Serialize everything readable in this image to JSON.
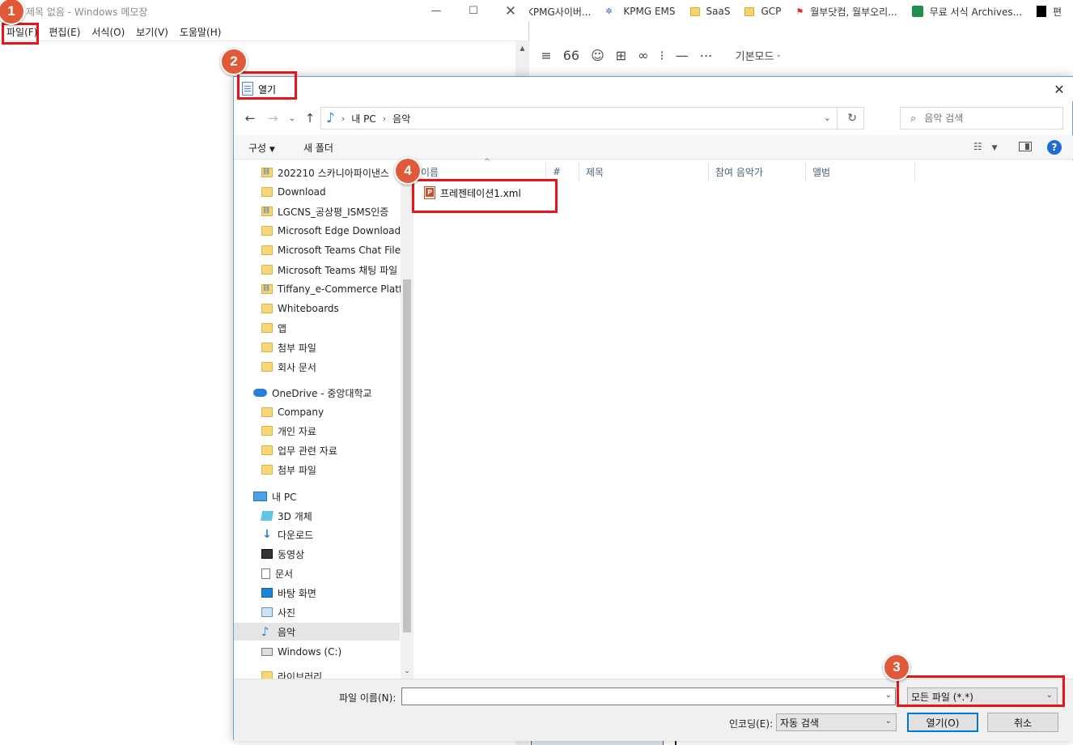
{
  "browser": {
    "bookmarks": [
      {
        "label": "정KPMG사이버...",
        "icon": "none"
      },
      {
        "label": "KPMG EMS",
        "icon": "kpmg-icon"
      },
      {
        "label": "SaaS",
        "icon": "folder-icon"
      },
      {
        "label": "GCP",
        "icon": "folder-icon"
      },
      {
        "label": "월부닷컴, 월부오리...",
        "icon": "flag-icon"
      },
      {
        "label": "무료 서식 Archives...",
        "icon": "green-icon"
      },
      {
        "label": "편",
        "icon": "black-icon"
      }
    ],
    "editor_toolbar": {
      "quote_glyph": "66",
      "mode_label": "기본모드"
    }
  },
  "notepad": {
    "title": "제목 없음 - Windows 메모장",
    "menus": [
      "파일(F)",
      "편집(E)",
      "서식(O)",
      "보기(V)",
      "도움말(H)"
    ]
  },
  "dialog": {
    "title": "열기",
    "breadcrumb": [
      "내 PC",
      "음악"
    ],
    "search_placeholder": "음악 검색",
    "commands": {
      "organize": "구성",
      "new_folder": "새 폴더"
    },
    "nav_items": [
      {
        "label": "202210 스카니아파이낸스",
        "icon": "link-folder-icon"
      },
      {
        "label": "Download",
        "icon": "folder-icon"
      },
      {
        "label": "LGCNS_공상평_ISMS인증",
        "icon": "link-folder-icon"
      },
      {
        "label": "Microsoft Edge Downloads",
        "icon": "folder-icon"
      },
      {
        "label": "Microsoft Teams Chat Files",
        "icon": "folder-icon"
      },
      {
        "label": "Microsoft Teams 채팅 파일",
        "icon": "folder-icon"
      },
      {
        "label": "Tiffany_e-Commerce Platform",
        "icon": "link-folder-icon"
      },
      {
        "label": "Whiteboards",
        "icon": "folder-icon"
      },
      {
        "label": "앱",
        "icon": "folder-icon"
      },
      {
        "label": "첨부 파일",
        "icon": "folder-icon"
      },
      {
        "label": "회사 문서",
        "icon": "folder-icon"
      },
      {
        "label": "OneDrive - 중앙대학교",
        "icon": "cloud-icon"
      },
      {
        "label": "Company",
        "icon": "folder-icon"
      },
      {
        "label": "개인 자료",
        "icon": "folder-icon"
      },
      {
        "label": "업무 관련 자료",
        "icon": "folder-icon"
      },
      {
        "label": "첨부 파일",
        "icon": "folder-icon"
      },
      {
        "label": "내 PC",
        "icon": "pc-icon"
      },
      {
        "label": "3D 개체",
        "icon": "cube-icon"
      },
      {
        "label": "다운로드",
        "icon": "download-icon"
      },
      {
        "label": "동영상",
        "icon": "video-icon"
      },
      {
        "label": "문서",
        "icon": "document-icon"
      },
      {
        "label": "바탕 화면",
        "icon": "desktop-icon"
      },
      {
        "label": "사진",
        "icon": "picture-icon"
      },
      {
        "label": "음악",
        "icon": "music-icon",
        "selected": true
      },
      {
        "label": "Windows (C:)",
        "icon": "drive-icon"
      },
      {
        "label": "라이브러리",
        "icon": "folder-icon"
      }
    ],
    "columns": [
      "이름",
      "#",
      "제목",
      "참여 음악가",
      "앨범"
    ],
    "files": [
      {
        "name": "프레젠테이션1.xml",
        "icon": "pptx-icon"
      }
    ],
    "filename_label": "파일 이름(N):",
    "filename_value": "",
    "filetype": "모든 파일 (*.*)",
    "encoding_label": "인코딩(E):",
    "encoding_value": "자동 검색",
    "open_button": "열기(O)",
    "cancel_button": "취소"
  },
  "annotations": {
    "badges": [
      "1",
      "2",
      "3",
      "4"
    ],
    "badge_color": "#e05a3a",
    "highlight_color": "#e8141c"
  }
}
